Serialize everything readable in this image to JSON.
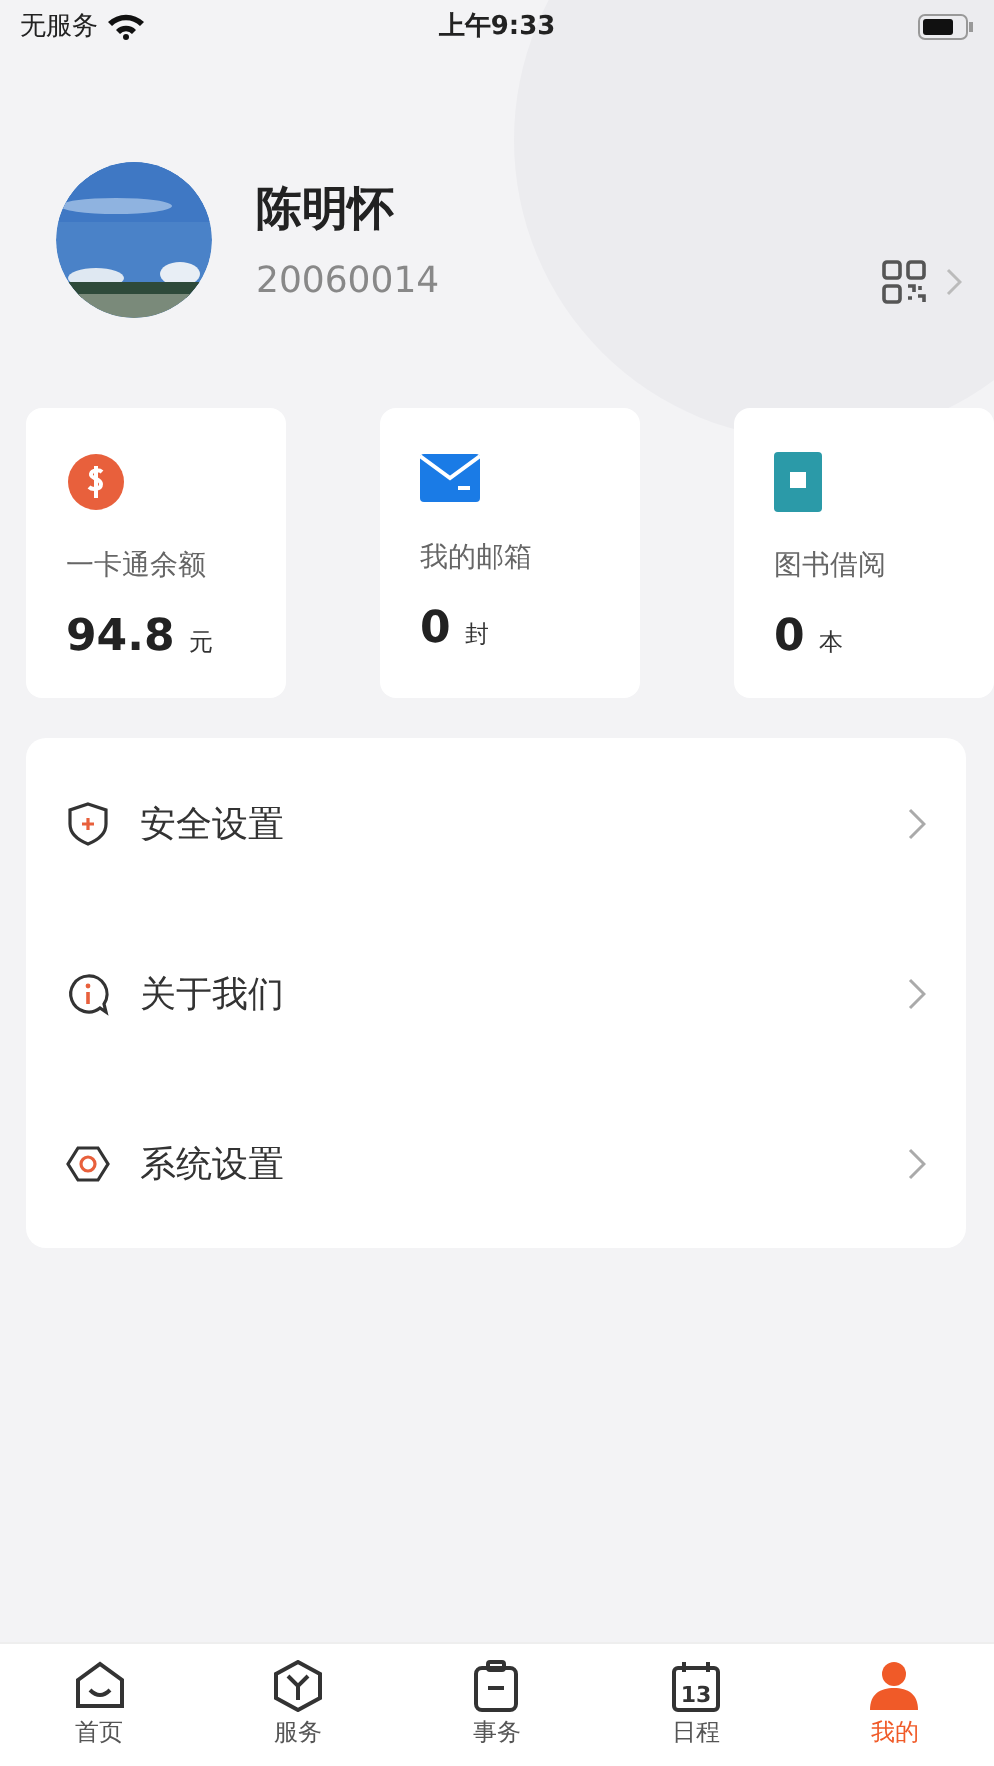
{
  "status_bar": {
    "carrier": "无服务",
    "time": "上午9:33"
  },
  "profile": {
    "name": "陈明怀",
    "id": "20060014"
  },
  "cards": [
    {
      "kind": "money",
      "label": "一卡通余额",
      "value": "94.8",
      "unit": "元"
    },
    {
      "kind": "mail",
      "label": "我的邮箱",
      "value": "0",
      "unit": "封"
    },
    {
      "kind": "book",
      "label": "图书借阅",
      "value": "0",
      "unit": "本"
    }
  ],
  "menu": [
    {
      "kind": "shield",
      "label": "安全设置"
    },
    {
      "kind": "info",
      "label": "关于我们"
    },
    {
      "kind": "gear",
      "label": "系统设置"
    }
  ],
  "tab_bar": [
    {
      "kind": "home",
      "label": "首页",
      "selected": false
    },
    {
      "kind": "service",
      "label": "服务",
      "selected": false
    },
    {
      "kind": "task",
      "label": "事务",
      "selected": false
    },
    {
      "kind": "calendar",
      "label": "日程",
      "selected": false,
      "icon_text": "13"
    },
    {
      "kind": "me",
      "label": "我的",
      "selected": true
    }
  ]
}
